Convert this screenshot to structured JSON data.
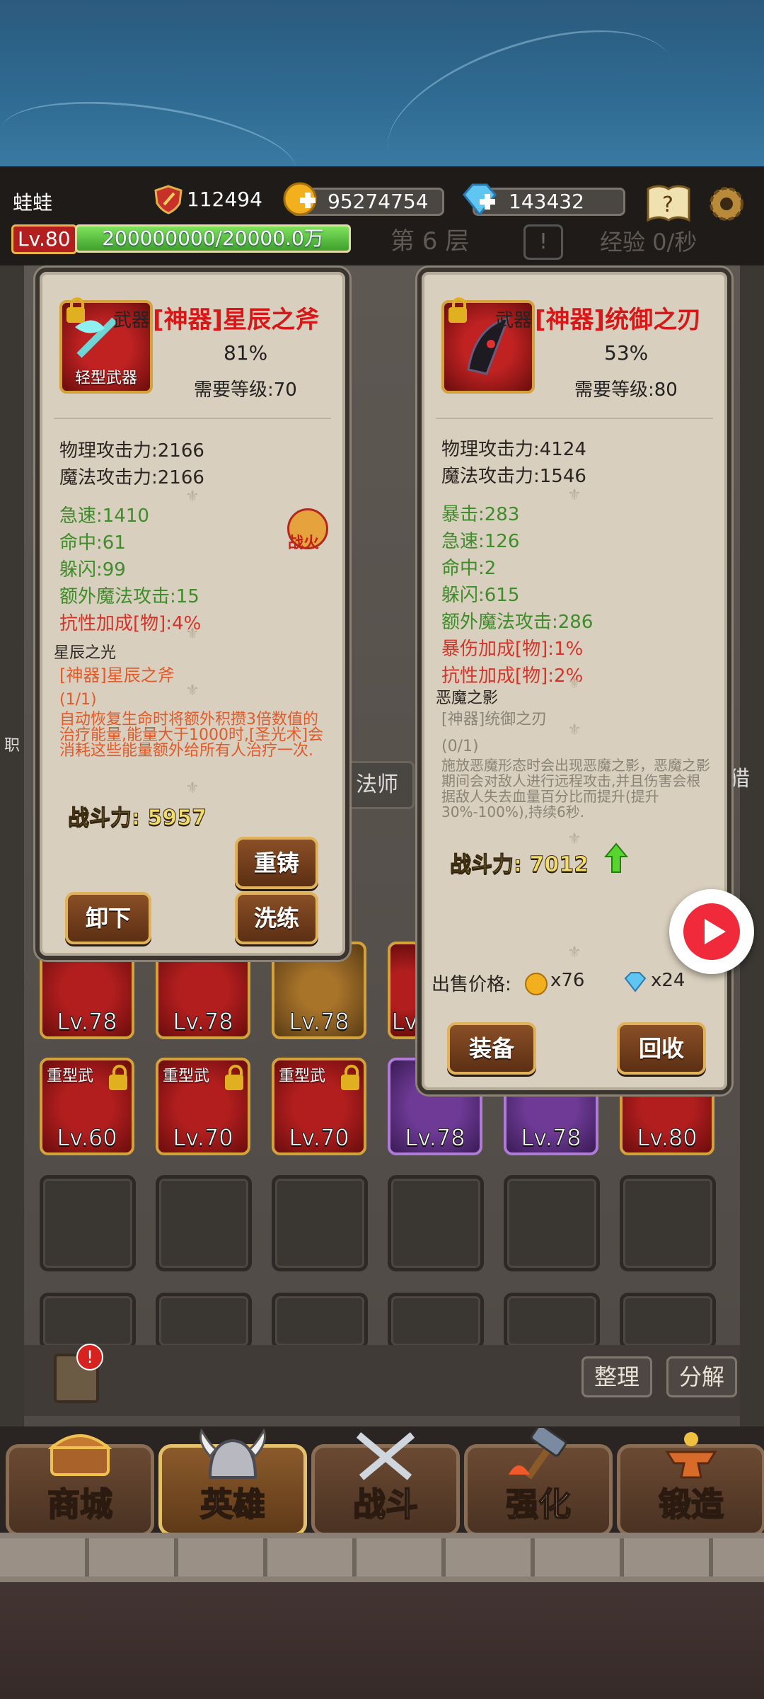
{
  "header": {
    "player_name": "蛙蛙",
    "combat_power": "112494",
    "gold": "95274754",
    "diamonds": "143432",
    "level": "Lv.80",
    "exp": "200000000/20000.0万",
    "floor": "第 6 层",
    "exp_rate": "经验 0/秒"
  },
  "left_panel": {
    "category": "武器",
    "title": "[神器]星辰之斧",
    "item_type": "轻型武器",
    "percent": "81%",
    "required_level": "需要等级:70",
    "badge": "战火",
    "base_stats": [
      "物理攻击力:2166",
      "魔法攻击力:2166"
    ],
    "bonus_stats": [
      "急速:1410",
      "命中:61",
      "躲闪:99",
      "额外魔法攻击:15"
    ],
    "red_stat": "抗性加成[物]:4%",
    "set_name": "星辰之光",
    "set_item": "[神器]星辰之斧",
    "set_count": "(1/1)",
    "set_desc": "自动恢复生命时将额外积攒3倍数值的治疗能量,能量大于1000时,[圣光术]会消耗这些能量额外给所有人治疗一次.",
    "power": "战斗力: 5957",
    "btn_reforge": "重铸",
    "btn_unequip": "卸下",
    "btn_refine": "洗练"
  },
  "right_panel": {
    "category": "武器",
    "title": "[神器]统御之刃",
    "percent": "53%",
    "required_level": "需要等级:80",
    "base_stats": [
      "物理攻击力:4124",
      "魔法攻击力:1546"
    ],
    "bonus_stats": [
      "暴击:283",
      "急速:126",
      "命中:2",
      "躲闪:615",
      "额外魔法攻击:286"
    ],
    "red_stats": [
      "暴伤加成[物]:1%",
      "抗性加成[物]:2%"
    ],
    "set_name": "恶魔之影",
    "set_item": "[神器]统御之刃",
    "set_count": "(0/1)",
    "set_desc": "施放恶魔形态时会出现恶魔之影，恶魔之影期间会对敌人进行远程攻击,并且伤害会根据敌人失去血量百分比而提升(提升30%-100%),持续6秒.",
    "power": "战斗力: 7012",
    "sell_label": "出售价格:",
    "sell_gold": "x76",
    "sell_gem": "x24",
    "btn_equip": "装备",
    "btn_recycle": "回收"
  },
  "inventory": {
    "row1_levels": [
      "Lv.78",
      "Lv.78",
      "Lv.78",
      "Lv"
    ],
    "row2": [
      {
        "tag": "重型武",
        "level": "Lv.60"
      },
      {
        "tag": "重型武",
        "level": "Lv.70"
      },
      {
        "tag": "重型武",
        "level": "Lv.70"
      },
      {
        "tag": "",
        "level": "Lv.78"
      },
      {
        "tag": "",
        "level": "Lv.78"
      },
      {
        "tag": "",
        "level": "Lv.80"
      }
    ],
    "hidden_label_1": "法师",
    "hidden_label_2": "职",
    "hidden_label_3": "猎",
    "btn_sort": "整理",
    "btn_decompose": "分解"
  },
  "nav": {
    "shop": "商城",
    "hero": "英雄",
    "battle": "战斗",
    "enhance": "强化",
    "forge": "锻造"
  },
  "colors": {
    "artifact_red": "#d81818",
    "stat_green": "#3f8c2a",
    "panel_bg": "#d9cfbe",
    "button_brown": "#7a4421"
  }
}
